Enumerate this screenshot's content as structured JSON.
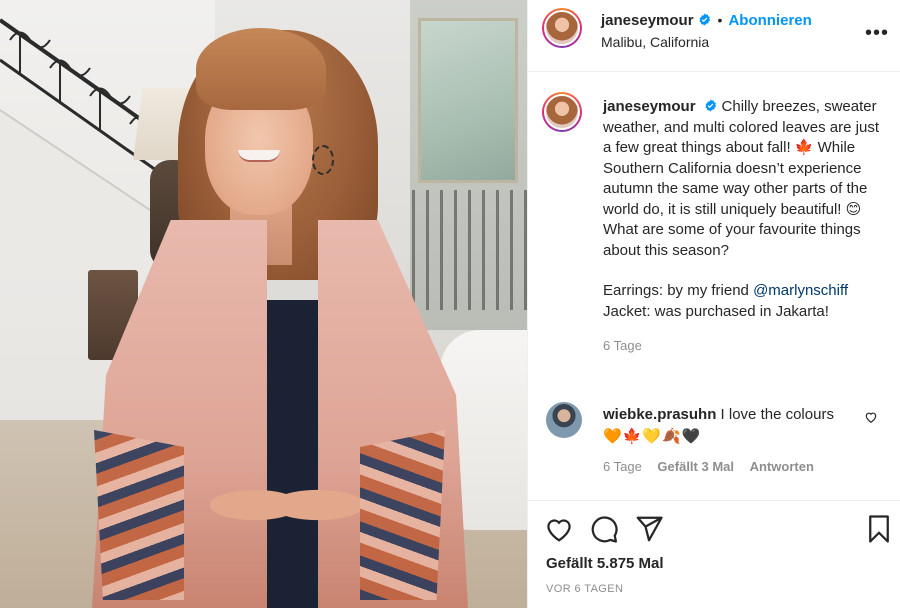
{
  "post": {
    "username": "janeseymour",
    "follow_label": "Abonnieren",
    "separator": "•",
    "location": "Malibu, California",
    "more_label": "•••"
  },
  "caption": {
    "username": "janeseymour",
    "line1": "Chilly breezes, sweater weather, and multi colored leaves are just a few great things about fall! 🍁 While Southern California doesn’t experience autumn the same way other parts of the world do, it is still uniquely beautiful! 😊 What are some of your favourite things about this season?",
    "earrings_prefix": "Earrings: by my friend ",
    "earrings_mention": "@marlynschiff",
    "jacket": "Jacket: was purchased in Jakarta!",
    "age": "6 Tage"
  },
  "comment": {
    "username": "wiebke.prasuhn",
    "text": "I love the colours",
    "emojis": "🧡🍁💛🍂🖤",
    "age": "6 Tage",
    "likes": "Gefällt 3 Mal",
    "reply_label": "Antworten"
  },
  "footer": {
    "likes": "Gefällt 5.875 Mal",
    "timestamp": "VOR 6 TAGEN"
  },
  "icons": [
    "verified-icon",
    "more-icon",
    "heart-icon",
    "comment-icon",
    "share-icon",
    "bookmark-icon"
  ],
  "colors": {
    "link": "#0095f6",
    "mention": "#00376b",
    "muted": "#8e8e8e",
    "text": "#262626"
  }
}
